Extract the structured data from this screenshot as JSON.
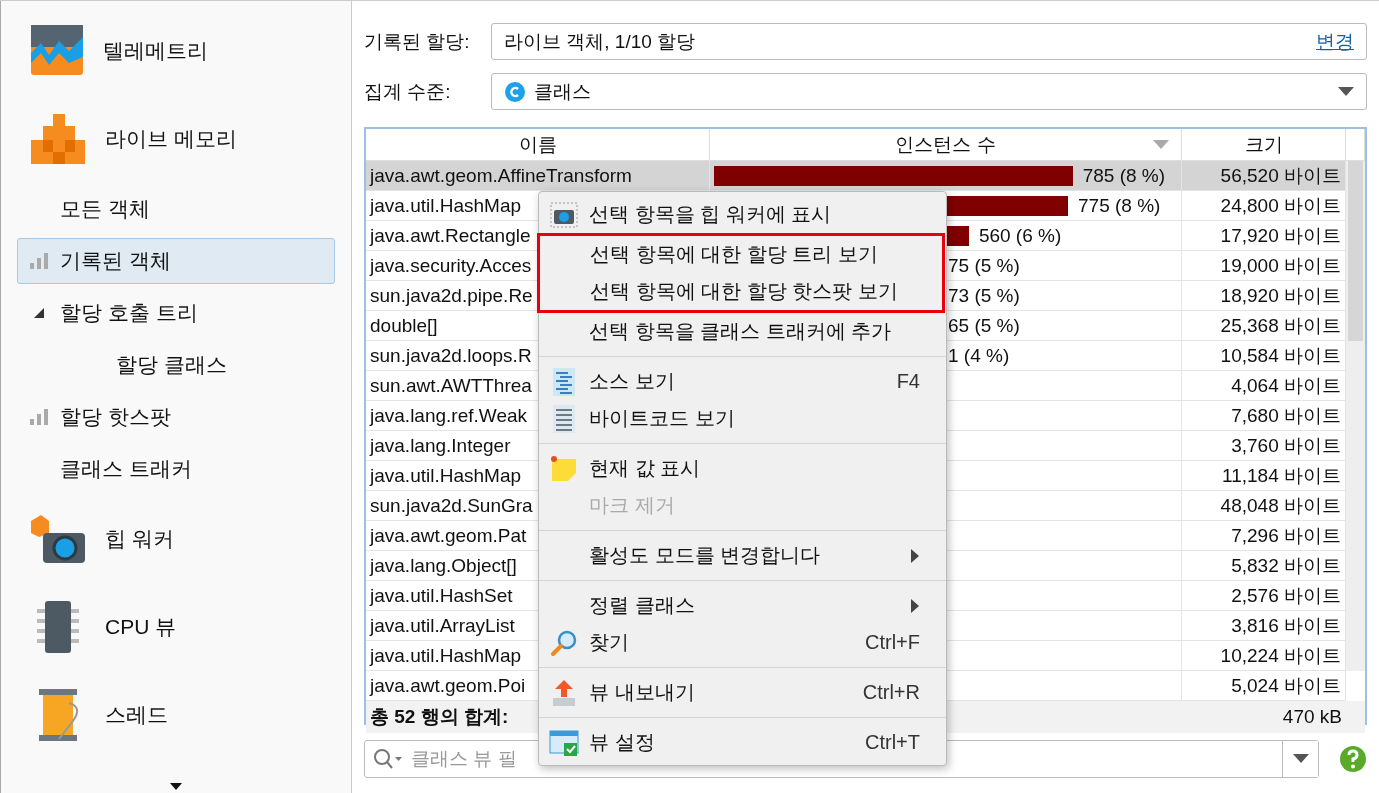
{
  "sidebar": {
    "items": [
      {
        "kind": "category",
        "label": "텔레메트리"
      },
      {
        "kind": "category",
        "label": "라이브 메모리"
      },
      {
        "kind": "view",
        "label": "모든 객체",
        "selected": false,
        "recorded": false
      },
      {
        "kind": "view",
        "label": "기록된 객체",
        "selected": true,
        "recorded": true
      },
      {
        "kind": "tree",
        "label": "할당 호출 트리",
        "selected": false,
        "expanded": true,
        "children": [
          {
            "kind": "view",
            "label": "할당 클래스",
            "selected": false,
            "recorded": false
          }
        ]
      },
      {
        "kind": "view",
        "label": "할당 핫스팟",
        "selected": false,
        "recorded": true
      },
      {
        "kind": "view",
        "label": "클래스 트래커",
        "selected": false,
        "recorded": false
      },
      {
        "kind": "category",
        "label": "힙 워커"
      },
      {
        "kind": "category",
        "label": "CPU 뷰"
      },
      {
        "kind": "category",
        "label": "스레드"
      }
    ]
  },
  "recorded_allocations": {
    "label": "기록된 할당:",
    "value": "라이브 객체, 1/10 할당",
    "link": "변경"
  },
  "aggregation": {
    "label": "집계 수준:",
    "value": "클래스"
  },
  "table": {
    "columns": [
      "이름",
      "인스턴스 수",
      "크기"
    ],
    "rows": [
      {
        "name": "java.awt.geom.AffineTransform",
        "count": "785 (8 %)",
        "level": 0.76,
        "size": "56,520 바이트",
        "selected": true
      },
      {
        "name": "java.util.HashMap",
        "count": "775 (8 %)",
        "level": 0.75,
        "size": "24,800 바이트",
        "selected": false
      },
      {
        "name": "java.awt.Rectangle",
        "count": "560 (6 %)",
        "level": 0.54,
        "size": "17,920 바이트",
        "selected": false
      },
      {
        "name": "java.security.Acces",
        "count": "75 (5 %)",
        "size": "19,000 바이트",
        "selected": false
      },
      {
        "name": "sun.java2d.pipe.Re",
        "count": "73 (5 %)",
        "size": "18,920 바이트",
        "selected": false
      },
      {
        "name": "double[]",
        "count": "65 (5 %)",
        "size": "25,368 바이트",
        "selected": false
      },
      {
        "name": "sun.java2d.loops.R",
        "count": "1 (4 %)",
        "size": "10,584 바이트",
        "selected": false
      },
      {
        "name": "sun.awt.AWTThrea",
        "size": "4,064 바이트",
        "selected": false
      },
      {
        "name": "java.lang.ref.Weak",
        "size": "7,680 바이트",
        "selected": false
      },
      {
        "name": "java.lang.Integer",
        "size": "3,760 바이트",
        "selected": false
      },
      {
        "name": "java.util.HashMap",
        "size": "11,184 바이트",
        "selected": false
      },
      {
        "name": "sun.java2d.SunGra",
        "size": "48,048 바이트",
        "selected": false
      },
      {
        "name": "java.awt.geom.Pat",
        "size": "7,296 바이트",
        "selected": false
      },
      {
        "name": "java.lang.Object[]",
        "size": "5,832 바이트",
        "selected": false
      },
      {
        "name": "java.util.HashSet",
        "size": "2,576 바이트",
        "selected": false
      },
      {
        "name": "java.util.ArrayList",
        "size": "3,816 바이트",
        "selected": false
      },
      {
        "name": "java.util.HashMap",
        "size": "10,224 바이트",
        "selected": false
      },
      {
        "name": "java.awt.geom.Poi",
        "size": "5,024 바이트",
        "selected": false
      }
    ],
    "footer": {
      "label": "총 52 행의 합계:",
      "size": "470 kB"
    }
  },
  "filter": {
    "placeholder": "클래스 뷰 필"
  },
  "context_menu": {
    "sections": [
      [
        {
          "kind": "item",
          "label": "선택 항목을 힙 워커에 표시",
          "disabled": false,
          "submenu": false
        },
        {
          "kind": "highlight",
          "items": [
            {
              "kind": "item",
              "label": "선택 항목에 대한 할당 트리 보기",
              "disabled": false,
              "submenu": false
            },
            {
              "kind": "item",
              "label": "선택 항목에 대한 할당 핫스팟 보기",
              "disabled": false,
              "submenu": false
            }
          ]
        },
        {
          "kind": "item",
          "label": "선택 항목을 클래스 트래커에 추가",
          "disabled": false,
          "submenu": false
        }
      ],
      [
        {
          "kind": "item",
          "label": "소스 보기",
          "shortcut": "F4",
          "disabled": false,
          "submenu": false
        },
        {
          "kind": "item",
          "label": "바이트코드 보기",
          "disabled": false,
          "submenu": false
        }
      ],
      [
        {
          "kind": "item",
          "label": "현재 값 표시",
          "disabled": false,
          "submenu": false
        },
        {
          "kind": "item",
          "label": "마크 제거",
          "disabled": true,
          "submenu": false
        }
      ],
      [
        {
          "kind": "item",
          "label": "활성도 모드를 변경합니다",
          "disabled": false,
          "submenu": true
        }
      ],
      [
        {
          "kind": "item",
          "label": "정렬 클래스",
          "disabled": false,
          "submenu": true
        },
        {
          "kind": "item",
          "label": "찾기",
          "shortcut": "Ctrl+F",
          "disabled": false,
          "submenu": false
        }
      ],
      [
        {
          "kind": "item",
          "label": "뷰 내보내기",
          "shortcut": "Ctrl+R",
          "disabled": false,
          "submenu": false
        }
      ],
      [
        {
          "kind": "item",
          "label": "뷰 설정",
          "shortcut": "Ctrl+T",
          "disabled": false,
          "submenu": false
        }
      ]
    ]
  }
}
